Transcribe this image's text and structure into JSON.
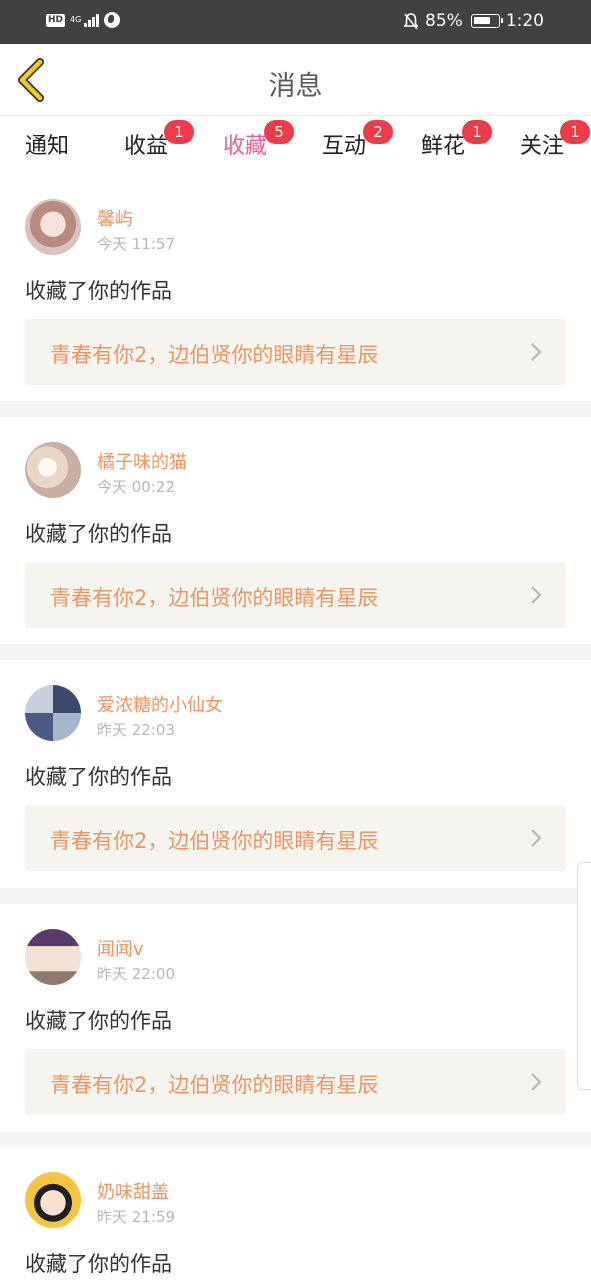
{
  "status_bar": {
    "hd": "HD",
    "network": "4G",
    "battery": "85%",
    "time": "1:20"
  },
  "header": {
    "title": "消息"
  },
  "tabs": [
    {
      "label": "通知",
      "badge": ""
    },
    {
      "label": "收益",
      "badge": "1"
    },
    {
      "label": "收藏",
      "badge": "5",
      "active": true
    },
    {
      "label": "互动",
      "badge": "2"
    },
    {
      "label": "鲜花",
      "badge": "1"
    },
    {
      "label": "关注",
      "badge": "1"
    }
  ],
  "items": [
    {
      "user": "馨屿",
      "time": "今天 11:57",
      "action": "收藏了你的作品",
      "work": "青春有你2，边伯贤你的眼睛有星辰",
      "avatar_icon": "avatar-girl-pink"
    },
    {
      "user": "橘子味的猫",
      "time": "今天 00:22",
      "action": "收藏了你的作品",
      "work": "青春有你2，边伯贤你的眼睛有星辰",
      "avatar_icon": "avatar-girl-sunset"
    },
    {
      "user": "爱浓糖的小仙女",
      "time": "昨天 22:03",
      "action": "收藏了你的作品",
      "work": "青春有你2，边伯贤你的眼睛有星辰",
      "avatar_icon": "avatar-collage"
    },
    {
      "user": "闻闻v",
      "time": "昨天 22:00",
      "action": "收藏了你的作品",
      "work": "青春有你2，边伯贤你的眼睛有星辰",
      "avatar_icon": "avatar-girl-purple-hat"
    },
    {
      "user": "奶味甜盖",
      "time": "昨天 21:59",
      "action": "收藏了你的作品",
      "work": "",
      "avatar_icon": "avatar-cartoon-boy"
    }
  ],
  "colors": {
    "accent": "#e8609a",
    "username": "#ef9565",
    "badge": "#ef3a4a",
    "work_bg": "#f5f4ee",
    "status_bar": "#414141",
    "back_icon": "#e8c200"
  }
}
